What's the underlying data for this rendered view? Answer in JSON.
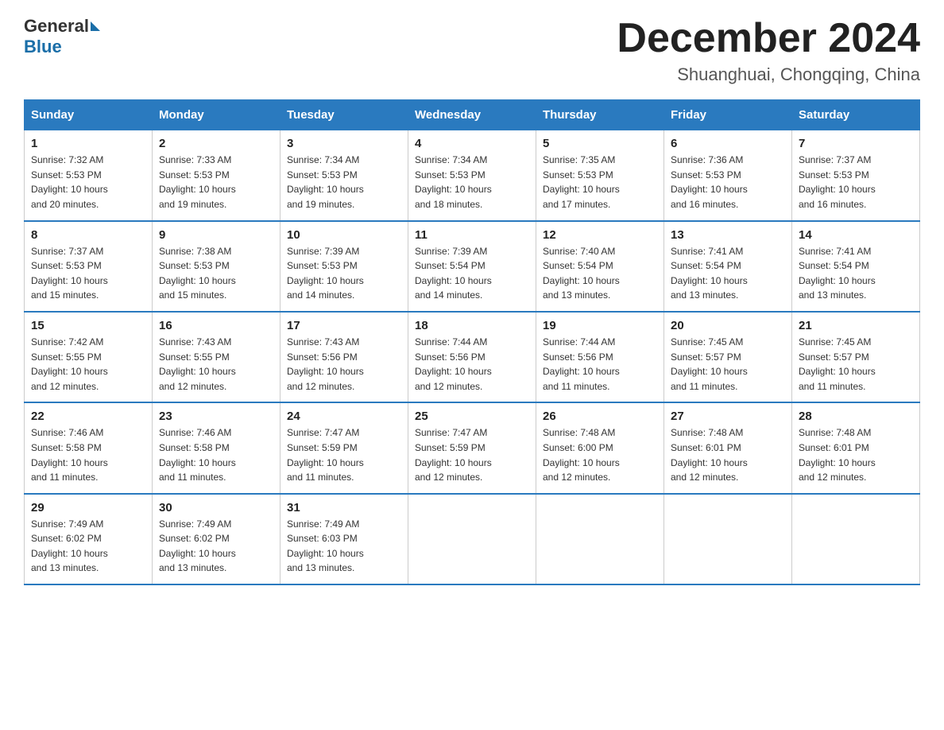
{
  "header": {
    "logo_general": "General",
    "logo_blue": "Blue",
    "month_title": "December 2024",
    "location": "Shuanghuai, Chongqing, China"
  },
  "weekdays": [
    "Sunday",
    "Monday",
    "Tuesday",
    "Wednesday",
    "Thursday",
    "Friday",
    "Saturday"
  ],
  "weeks": [
    [
      {
        "day": "1",
        "sunrise": "7:32 AM",
        "sunset": "5:53 PM",
        "daylight": "10 hours and 20 minutes."
      },
      {
        "day": "2",
        "sunrise": "7:33 AM",
        "sunset": "5:53 PM",
        "daylight": "10 hours and 19 minutes."
      },
      {
        "day": "3",
        "sunrise": "7:34 AM",
        "sunset": "5:53 PM",
        "daylight": "10 hours and 19 minutes."
      },
      {
        "day": "4",
        "sunrise": "7:34 AM",
        "sunset": "5:53 PM",
        "daylight": "10 hours and 18 minutes."
      },
      {
        "day": "5",
        "sunrise": "7:35 AM",
        "sunset": "5:53 PM",
        "daylight": "10 hours and 17 minutes."
      },
      {
        "day": "6",
        "sunrise": "7:36 AM",
        "sunset": "5:53 PM",
        "daylight": "10 hours and 16 minutes."
      },
      {
        "day": "7",
        "sunrise": "7:37 AM",
        "sunset": "5:53 PM",
        "daylight": "10 hours and 16 minutes."
      }
    ],
    [
      {
        "day": "8",
        "sunrise": "7:37 AM",
        "sunset": "5:53 PM",
        "daylight": "10 hours and 15 minutes."
      },
      {
        "day": "9",
        "sunrise": "7:38 AM",
        "sunset": "5:53 PM",
        "daylight": "10 hours and 15 minutes."
      },
      {
        "day": "10",
        "sunrise": "7:39 AM",
        "sunset": "5:53 PM",
        "daylight": "10 hours and 14 minutes."
      },
      {
        "day": "11",
        "sunrise": "7:39 AM",
        "sunset": "5:54 PM",
        "daylight": "10 hours and 14 minutes."
      },
      {
        "day": "12",
        "sunrise": "7:40 AM",
        "sunset": "5:54 PM",
        "daylight": "10 hours and 13 minutes."
      },
      {
        "day": "13",
        "sunrise": "7:41 AM",
        "sunset": "5:54 PM",
        "daylight": "10 hours and 13 minutes."
      },
      {
        "day": "14",
        "sunrise": "7:41 AM",
        "sunset": "5:54 PM",
        "daylight": "10 hours and 13 minutes."
      }
    ],
    [
      {
        "day": "15",
        "sunrise": "7:42 AM",
        "sunset": "5:55 PM",
        "daylight": "10 hours and 12 minutes."
      },
      {
        "day": "16",
        "sunrise": "7:43 AM",
        "sunset": "5:55 PM",
        "daylight": "10 hours and 12 minutes."
      },
      {
        "day": "17",
        "sunrise": "7:43 AM",
        "sunset": "5:56 PM",
        "daylight": "10 hours and 12 minutes."
      },
      {
        "day": "18",
        "sunrise": "7:44 AM",
        "sunset": "5:56 PM",
        "daylight": "10 hours and 12 minutes."
      },
      {
        "day": "19",
        "sunrise": "7:44 AM",
        "sunset": "5:56 PM",
        "daylight": "10 hours and 11 minutes."
      },
      {
        "day": "20",
        "sunrise": "7:45 AM",
        "sunset": "5:57 PM",
        "daylight": "10 hours and 11 minutes."
      },
      {
        "day": "21",
        "sunrise": "7:45 AM",
        "sunset": "5:57 PM",
        "daylight": "10 hours and 11 minutes."
      }
    ],
    [
      {
        "day": "22",
        "sunrise": "7:46 AM",
        "sunset": "5:58 PM",
        "daylight": "10 hours and 11 minutes."
      },
      {
        "day": "23",
        "sunrise": "7:46 AM",
        "sunset": "5:58 PM",
        "daylight": "10 hours and 11 minutes."
      },
      {
        "day": "24",
        "sunrise": "7:47 AM",
        "sunset": "5:59 PM",
        "daylight": "10 hours and 11 minutes."
      },
      {
        "day": "25",
        "sunrise": "7:47 AM",
        "sunset": "5:59 PM",
        "daylight": "10 hours and 12 minutes."
      },
      {
        "day": "26",
        "sunrise": "7:48 AM",
        "sunset": "6:00 PM",
        "daylight": "10 hours and 12 minutes."
      },
      {
        "day": "27",
        "sunrise": "7:48 AM",
        "sunset": "6:01 PM",
        "daylight": "10 hours and 12 minutes."
      },
      {
        "day": "28",
        "sunrise": "7:48 AM",
        "sunset": "6:01 PM",
        "daylight": "10 hours and 12 minutes."
      }
    ],
    [
      {
        "day": "29",
        "sunrise": "7:49 AM",
        "sunset": "6:02 PM",
        "daylight": "10 hours and 13 minutes."
      },
      {
        "day": "30",
        "sunrise": "7:49 AM",
        "sunset": "6:02 PM",
        "daylight": "10 hours and 13 minutes."
      },
      {
        "day": "31",
        "sunrise": "7:49 AM",
        "sunset": "6:03 PM",
        "daylight": "10 hours and 13 minutes."
      },
      null,
      null,
      null,
      null
    ]
  ],
  "labels": {
    "sunrise": "Sunrise:",
    "sunset": "Sunset:",
    "daylight": "Daylight:"
  }
}
